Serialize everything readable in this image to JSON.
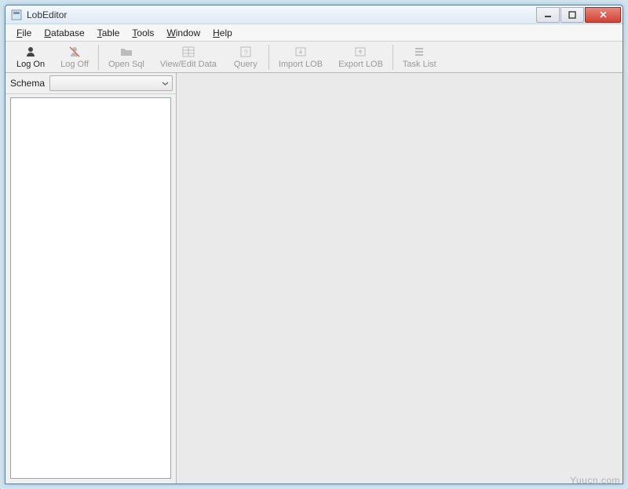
{
  "titlebar": {
    "title": "LobEditor"
  },
  "menu": {
    "items": [
      {
        "label": "File",
        "ul": "F",
        "rest": "ile"
      },
      {
        "label": "Database",
        "ul": "D",
        "rest": "atabase"
      },
      {
        "label": "Table",
        "ul": "T",
        "rest": "able"
      },
      {
        "label": "Tools",
        "ul": "T",
        "rest": "ools"
      },
      {
        "label": "Window",
        "ul": "W",
        "rest": "indow"
      },
      {
        "label": "Help",
        "ul": "H",
        "rest": "elp"
      }
    ]
  },
  "toolbar": {
    "buttons": [
      {
        "label": "Log On",
        "enabled": true
      },
      {
        "label": "Log Off",
        "enabled": false
      },
      {
        "label": "Open Sql",
        "enabled": false
      },
      {
        "label": "View/Edit Data",
        "enabled": false
      },
      {
        "label": "Query",
        "enabled": false
      },
      {
        "label": "Import LOB",
        "enabled": false
      },
      {
        "label": "Export LOB",
        "enabled": false
      },
      {
        "label": "Task List",
        "enabled": false
      }
    ]
  },
  "sidebar": {
    "schema_label": "Schema",
    "schema_value": ""
  },
  "watermark": "Yuucn.com"
}
